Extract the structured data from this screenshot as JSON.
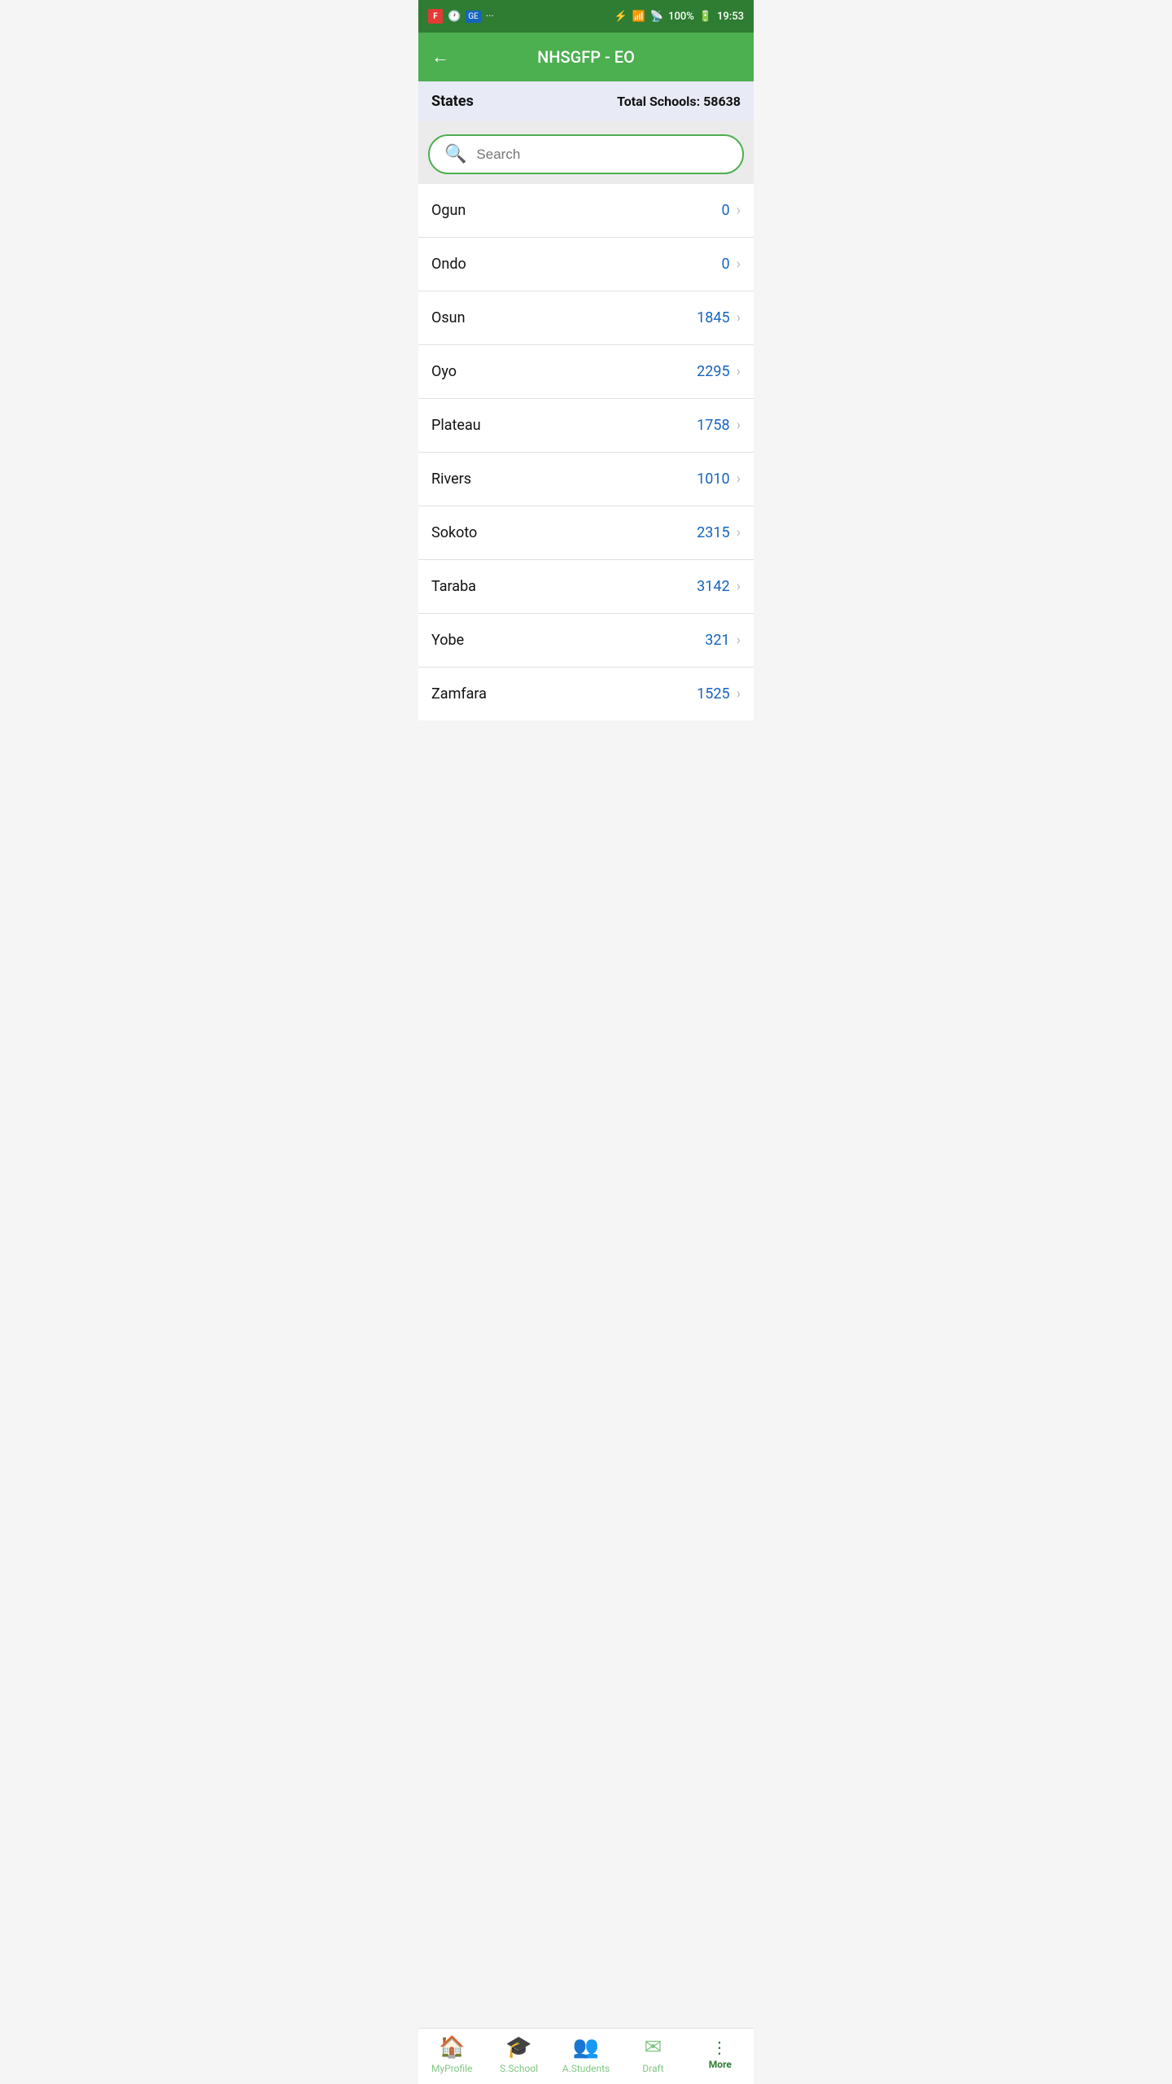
{
  "statusBar": {
    "time": "19:53",
    "battery": "100%",
    "icons": {
      "bluetooth": "⚡",
      "wifi": "wifi",
      "signal": "signal",
      "battery_icon": "🔋"
    }
  },
  "appBar": {
    "title": "NHSGFP - EO",
    "backLabel": "←"
  },
  "headerInfo": {
    "statesLabel": "States",
    "totalSchoolsLabel": "Total Schools: 58638"
  },
  "search": {
    "placeholder": "Search"
  },
  "listItems": [
    {
      "name": "Ogun",
      "count": "0"
    },
    {
      "name": "Ondo",
      "count": "0"
    },
    {
      "name": "Osun",
      "count": "1845"
    },
    {
      "name": "Oyo",
      "count": "2295"
    },
    {
      "name": "Plateau",
      "count": "1758"
    },
    {
      "name": "Rivers",
      "count": "1010"
    },
    {
      "name": "Sokoto",
      "count": "2315"
    },
    {
      "name": "Taraba",
      "count": "3142"
    },
    {
      "name": "Yobe",
      "count": "321"
    },
    {
      "name": "Zamfara",
      "count": "1525"
    }
  ],
  "bottomNav": [
    {
      "id": "my-profile",
      "label": "MyProfile",
      "icon": "🏠",
      "active": false
    },
    {
      "id": "s-school",
      "label": "S.School",
      "icon": "🎓",
      "active": false
    },
    {
      "id": "a-students",
      "label": "A.Students",
      "icon": "👥",
      "active": false
    },
    {
      "id": "draft",
      "label": "Draft",
      "icon": "✉",
      "active": false
    },
    {
      "id": "more",
      "label": "More",
      "icon": "more",
      "active": true
    }
  ]
}
